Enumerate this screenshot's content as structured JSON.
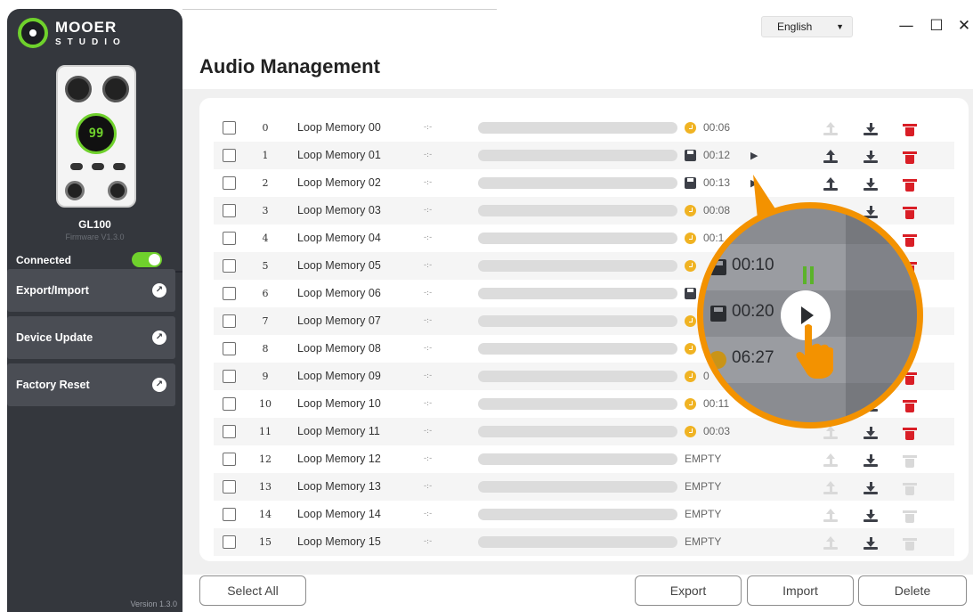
{
  "app": {
    "logo_main": "MOOER",
    "logo_sub": "STUDIO"
  },
  "sidebar": {
    "pedal_display": "99",
    "device_name": "GL100",
    "firmware": "Firmware V1.3.0",
    "connection_label": "Connected",
    "connected": true,
    "items": [
      {
        "label": "Export/Import",
        "icon": "arrow-up-right-icon"
      },
      {
        "label": "Device Update",
        "icon": "arrow-up-right-icon"
      },
      {
        "label": "Factory Reset",
        "icon": "arrow-up-right-icon"
      }
    ],
    "version": "Version 1.3.0"
  },
  "header": {
    "language": "English",
    "page_title": "Audio Management",
    "window_controls": [
      "minimize",
      "maximize",
      "close"
    ]
  },
  "colors": {
    "accent_green": "#6fd12c",
    "accent_orange": "#f39200",
    "delete_red": "#d91e26",
    "sidebar_bg": "#34373d"
  },
  "rows": [
    {
      "index": "0",
      "name": "Loop Memory 00",
      "time": "-:-",
      "status_icon": "clock-icon",
      "status": "00:06",
      "play": false,
      "upload": false,
      "delete": true
    },
    {
      "index": "1",
      "name": "Loop Memory 01",
      "time": "-:-",
      "status_icon": "disk-icon",
      "status": "00:12",
      "play": true,
      "upload": true,
      "delete": true
    },
    {
      "index": "2",
      "name": "Loop Memory 02",
      "time": "-:-",
      "status_icon": "disk-icon",
      "status": "00:13",
      "play": true,
      "upload": true,
      "delete": true
    },
    {
      "index": "3",
      "name": "Loop Memory 03",
      "time": "-:-",
      "status_icon": "clock-icon",
      "status": "00:08",
      "play": false,
      "upload": false,
      "delete": true
    },
    {
      "index": "4",
      "name": "Loop Memory 04",
      "time": "-:-",
      "status_icon": "clock-icon",
      "status": "00:1",
      "play": false,
      "upload": false,
      "delete": true
    },
    {
      "index": "5",
      "name": "Loop Memory 05",
      "time": "-:-",
      "status_icon": "clock-icon",
      "status": "",
      "play": false,
      "upload": false,
      "delete": true
    },
    {
      "index": "6",
      "name": "Loop Memory 06",
      "time": "-:-",
      "status_icon": "disk-icon",
      "status": "",
      "play": false,
      "upload": false,
      "delete": true
    },
    {
      "index": "7",
      "name": "Loop Memory 07",
      "time": "-:-",
      "status_icon": "clock-icon",
      "status": "",
      "play": false,
      "upload": false,
      "delete": true
    },
    {
      "index": "8",
      "name": "Loop Memory 08",
      "time": "-:-",
      "status_icon": "clock-icon",
      "status": "",
      "play": false,
      "upload": false,
      "delete": true
    },
    {
      "index": "9",
      "name": "Loop Memory 09",
      "time": "-:-",
      "status_icon": "clock-icon",
      "status": "0",
      "play": false,
      "upload": false,
      "delete": true
    },
    {
      "index": "10",
      "name": "Loop Memory 10",
      "time": "-:-",
      "status_icon": "clock-icon",
      "status": "00:11",
      "play": false,
      "upload": false,
      "delete": true
    },
    {
      "index": "11",
      "name": "Loop Memory 11",
      "time": "-:-",
      "status_icon": "clock-icon",
      "status": "00:03",
      "play": false,
      "upload": false,
      "delete": true
    },
    {
      "index": "12",
      "name": "Loop Memory 12",
      "time": "-:-",
      "status_icon": "",
      "status": "EMPTY",
      "play": false,
      "upload": false,
      "delete": false
    },
    {
      "index": "13",
      "name": "Loop Memory 13",
      "time": "-:-",
      "status_icon": "",
      "status": "EMPTY",
      "play": false,
      "upload": false,
      "delete": false
    },
    {
      "index": "14",
      "name": "Loop Memory 14",
      "time": "-:-",
      "status_icon": "",
      "status": "EMPTY",
      "play": false,
      "upload": false,
      "delete": false
    },
    {
      "index": "15",
      "name": "Loop Memory 15",
      "time": "-:-",
      "status_icon": "",
      "status": "EMPTY",
      "play": false,
      "upload": false,
      "delete": false
    }
  ],
  "magnifier": {
    "rows": [
      {
        "status_icon": "disk-icon",
        "time": "00:10",
        "state": "playing"
      },
      {
        "status_icon": "disk-icon",
        "time": "00:20",
        "state": "play"
      },
      {
        "status_icon": "clock-icon",
        "time": "06:27",
        "state": ""
      }
    ]
  },
  "footer": {
    "select_all": "Select All",
    "export": "Export",
    "import": "Import",
    "delete": "Delete"
  }
}
